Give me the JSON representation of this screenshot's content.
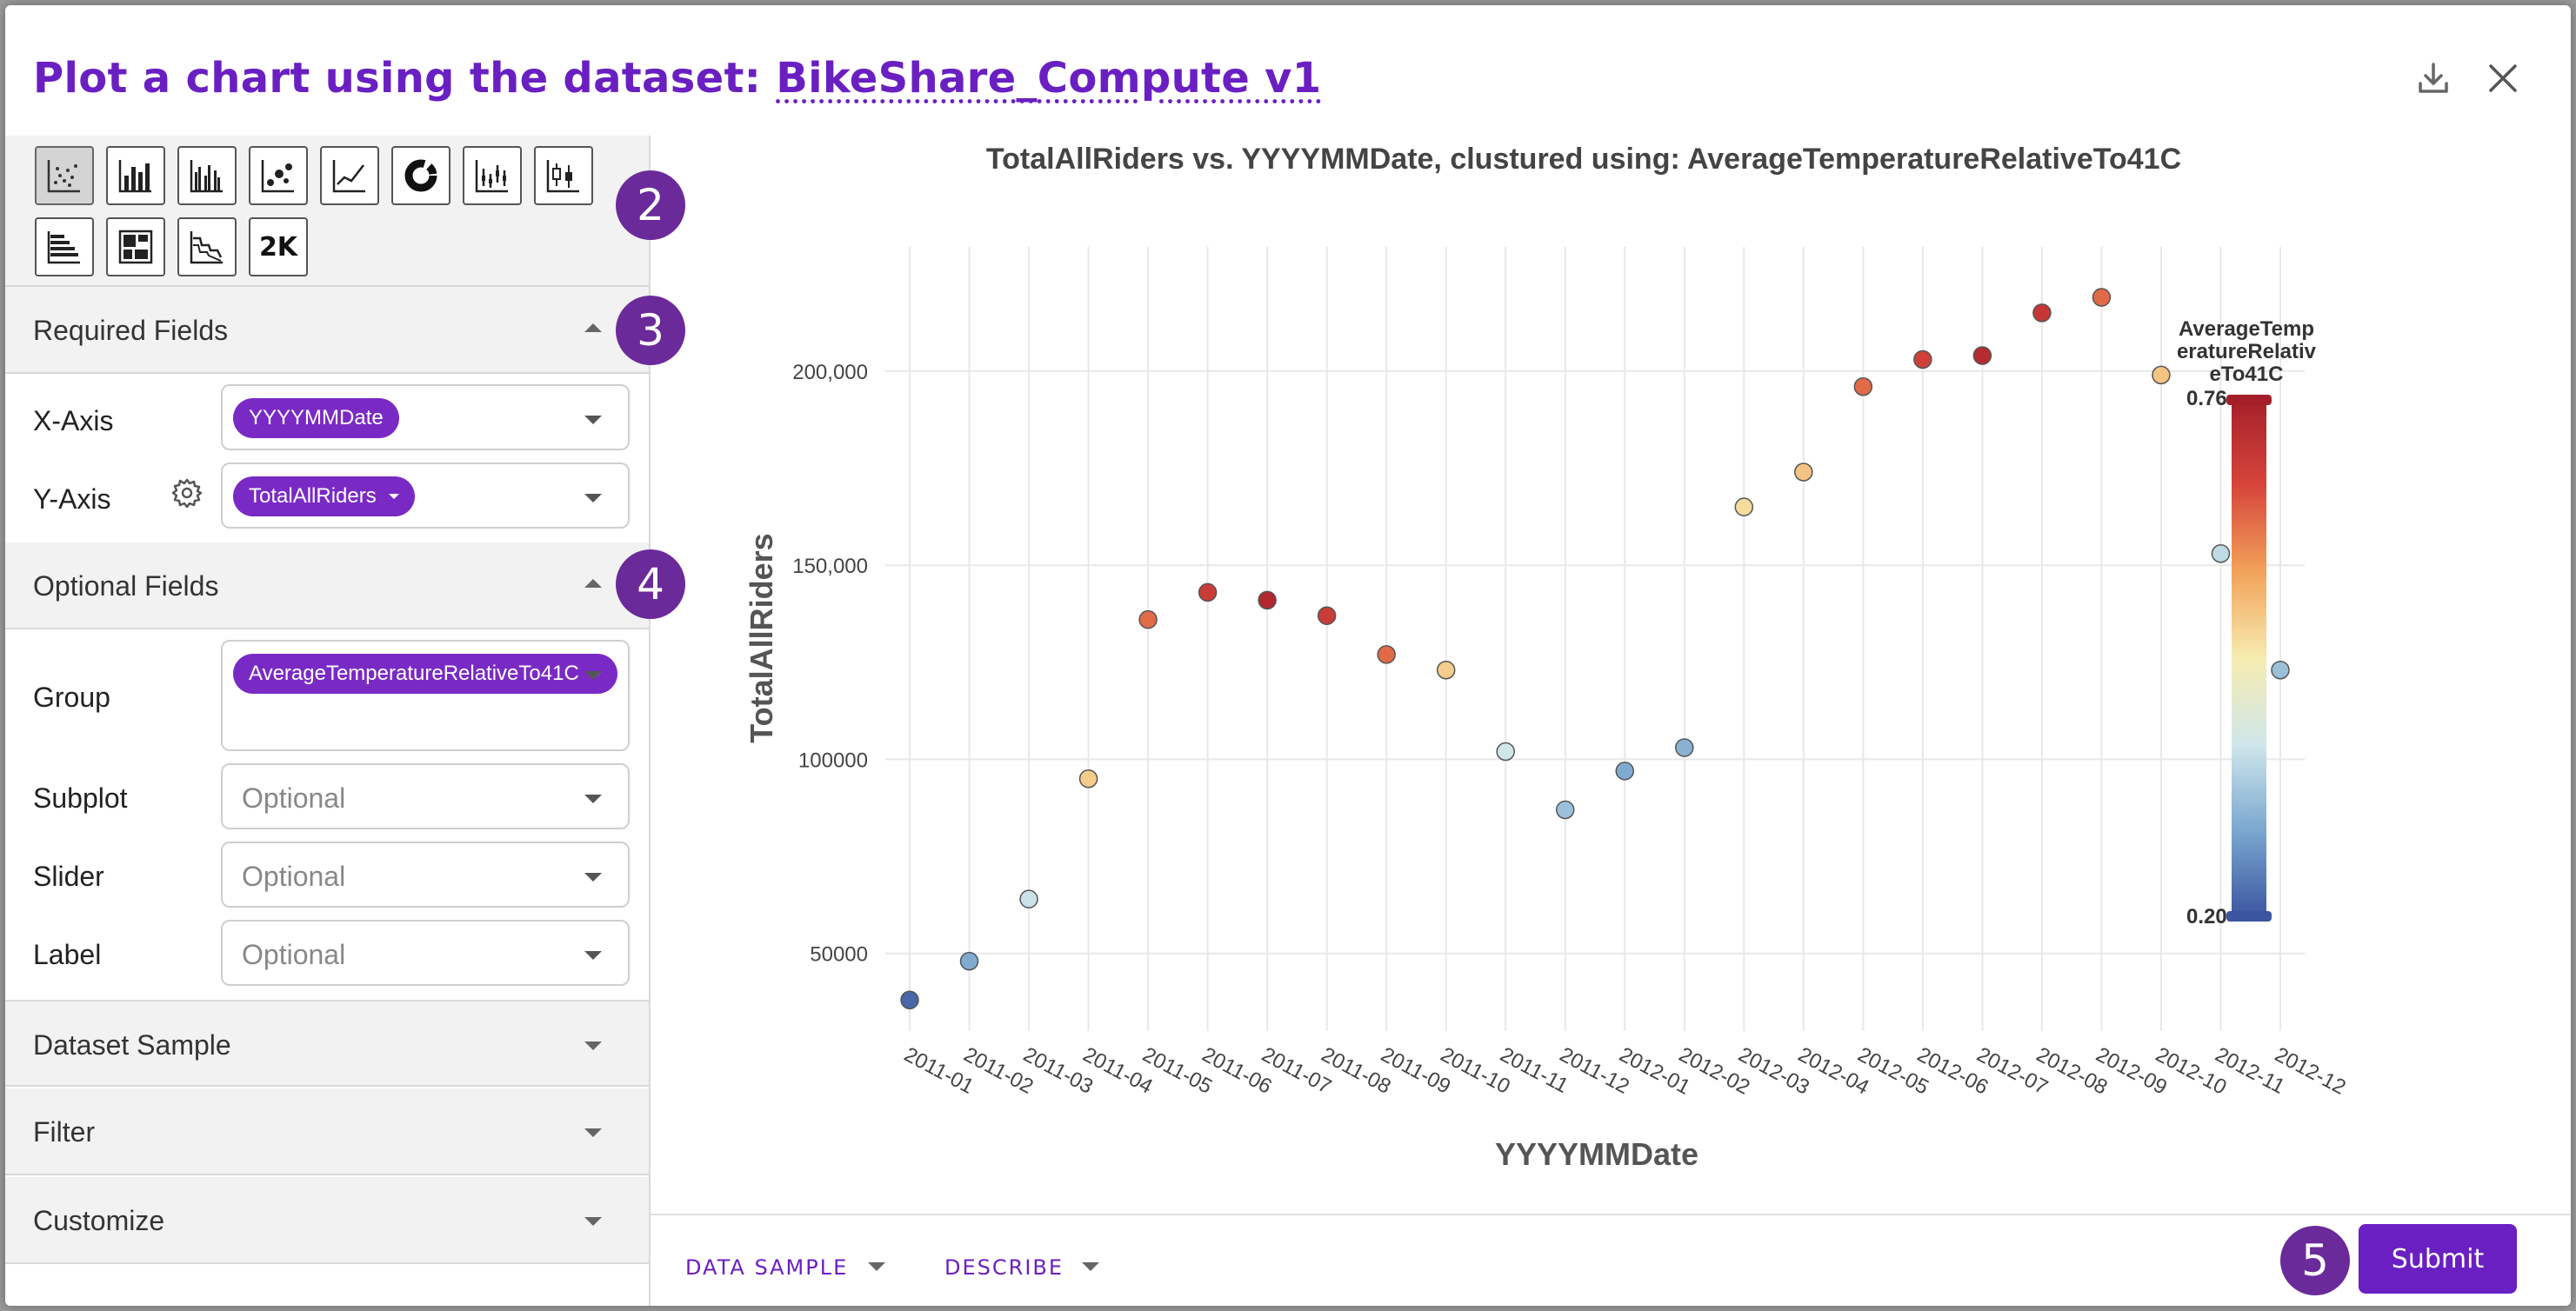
{
  "header": {
    "title_prefix": "Plot a chart using the dataset: ",
    "dataset_name": "BikeShare_Compute v1"
  },
  "chart_types": [
    {
      "icon": "scatter-plot-icon",
      "active": true
    },
    {
      "icon": "bar-chart-icon"
    },
    {
      "icon": "grouped-bar-chart-icon"
    },
    {
      "icon": "bubble-chart-icon"
    },
    {
      "icon": "line-chart-icon"
    },
    {
      "icon": "donut-chart-icon"
    },
    {
      "icon": "strip-chart-icon"
    },
    {
      "icon": "candlestick-chart-icon"
    },
    {
      "icon": "horizontal-bar-chart-icon"
    },
    {
      "icon": "treemap-icon"
    },
    {
      "icon": "stacked-area-chart-icon"
    },
    {
      "icon": "2k-icon",
      "text": "2K"
    }
  ],
  "steps": {
    "s2": "2",
    "s3": "3",
    "s4": "4",
    "s5": "5"
  },
  "required": {
    "title": "Required Fields",
    "x_label": "X-Axis",
    "x_value": "YYYYMMDate",
    "y_label": "Y-Axis",
    "y_value": "TotalAllRiders"
  },
  "optional": {
    "title": "Optional Fields",
    "group_label": "Group",
    "group_value": "AverageTemperatureRelativeTo41C",
    "subplot_label": "Subplot",
    "slider_label": "Slider",
    "label_label": "Label",
    "placeholder": "Optional"
  },
  "sections": {
    "dataset_sample": "Dataset Sample",
    "filter": "Filter",
    "customize": "Customize"
  },
  "footer": {
    "data_sample": "DATA SAMPLE",
    "describe": "DESCRIBE",
    "submit": "Submit"
  },
  "chart_data": {
    "type": "scatter",
    "title": "TotalAllRiders vs. YYYYMMDate, clustured using: AverageTemperatureRelativeTo41C",
    "xlabel": "YYYYMMDate",
    "ylabel": "TotalAllRiders",
    "categories": [
      "2011-01",
      "2011-02",
      "2011-03",
      "2011-04",
      "2011-05",
      "2011-06",
      "2011-07",
      "2011-08",
      "2011-09",
      "2011-10",
      "2011-11",
      "2011-12",
      "2012-01",
      "2012-02",
      "2012-03",
      "2012-04",
      "2012-05",
      "2012-06",
      "2012-07",
      "2012-08",
      "2012-09",
      "2012-10",
      "2012-11",
      "2012-12"
    ],
    "values": [
      38000,
      48000,
      64000,
      95000,
      136000,
      143000,
      141000,
      137000,
      127000,
      123000,
      102000,
      87000,
      97000,
      103000,
      165000,
      174000,
      196000,
      203000,
      204000,
      215000,
      219000,
      199000,
      153000,
      123000
    ],
    "color_values": [
      0.22,
      0.3,
      0.38,
      0.52,
      0.63,
      0.69,
      0.74,
      0.69,
      0.63,
      0.52,
      0.39,
      0.33,
      0.3,
      0.31,
      0.5,
      0.53,
      0.63,
      0.68,
      0.73,
      0.7,
      0.63,
      0.53,
      0.37,
      0.33
    ],
    "y_ticks": [
      50000,
      100000,
      150000,
      200000
    ],
    "y_tick_labels": [
      "50000",
      "100000",
      "150,000",
      "200,000"
    ],
    "ylim": [
      30000,
      232000
    ],
    "grid": true,
    "colorbar": {
      "title_lines": [
        "AverageTemp",
        "eratureRelativ",
        "eTo41C"
      ],
      "min": 0.2,
      "max": 0.76,
      "min_label": "0.20",
      "max_label": "0.76",
      "colorscale": [
        "#3b55a0",
        "#79a7cf",
        "#cfe6ea",
        "#f6ecb0",
        "#f2a25a",
        "#d6453b",
        "#a51f2a"
      ],
      "placement": "right"
    }
  }
}
